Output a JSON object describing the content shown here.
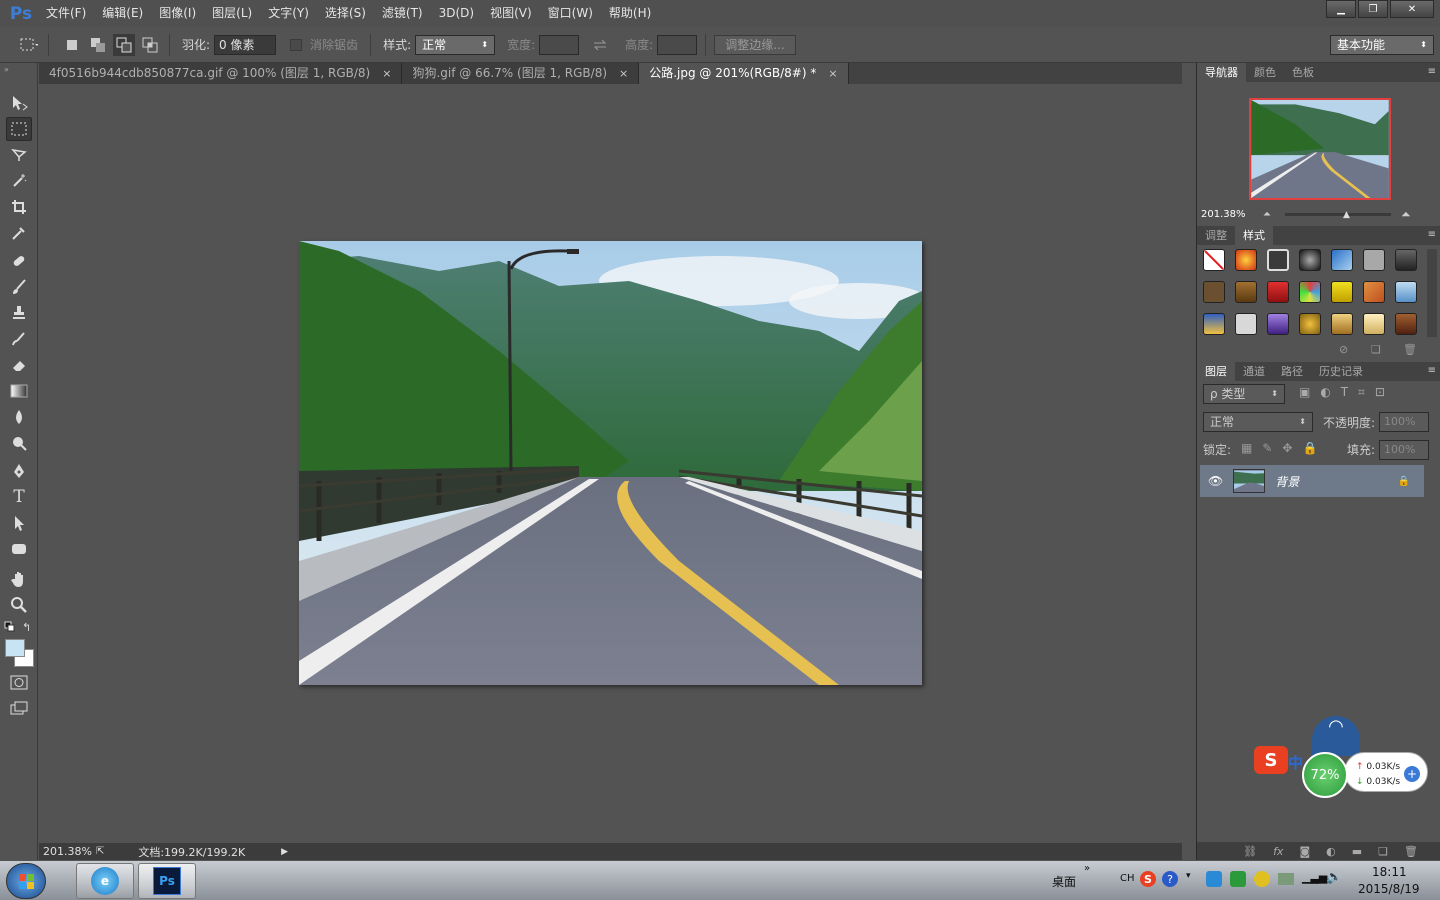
{
  "app": {
    "logo": "Ps"
  },
  "menu": [
    "文件(F)",
    "编辑(E)",
    "图像(I)",
    "图层(L)",
    "文字(Y)",
    "选择(S)",
    "滤镜(T)",
    "3D(D)",
    "视图(V)",
    "窗口(W)",
    "帮助(H)"
  ],
  "window_controls": {
    "minimize": "▁",
    "restore": "❐",
    "close": "✕"
  },
  "options": {
    "feather_label": "羽化:",
    "feather_value": "0 像素",
    "antialias_label": "消除锯齿",
    "style_label": "样式:",
    "style_value": "正常",
    "width_label": "宽度:",
    "height_label": "高度:",
    "refine_edge": "调整边缘...",
    "workspace": "基本功能"
  },
  "doc_tabs": [
    {
      "label": "4f0516b944cdb850877ca.gif @ 100% (图层 1, RGB/8)",
      "close": "×"
    },
    {
      "label": "狗狗.gif @ 66.7% (图层 1, RGB/8)",
      "close": "×"
    },
    {
      "label": "公路.jpg @ 201%(RGB/8#) *",
      "close": "×"
    }
  ],
  "status": {
    "zoom": "201.38%",
    "doc": "文档:199.2K/199.2K"
  },
  "navigator": {
    "tabs": [
      "导航器",
      "颜色",
      "色板"
    ],
    "zoom": "201.38%"
  },
  "styles": {
    "tabs": [
      "调整",
      "样式"
    ]
  },
  "layers": {
    "tabs": [
      "图层",
      "通道",
      "路径",
      "历史记录"
    ],
    "filter_kind": "ρ 类型",
    "blend_mode": "正常",
    "opacity_label": "不透明度:",
    "opacity_value": "100%",
    "lock_label": "锁定:",
    "fill_label": "填充:",
    "fill_value": "100%",
    "layer_name": "背景"
  },
  "widget": {
    "percent": "72%",
    "up": "0.03K/s",
    "down": "0.03K/s",
    "ime": "中"
  },
  "taskbar": {
    "desktop": "桌面",
    "lang": "CH",
    "time": "18:11",
    "date": "2015/8/19",
    "ps_label": "Ps"
  }
}
